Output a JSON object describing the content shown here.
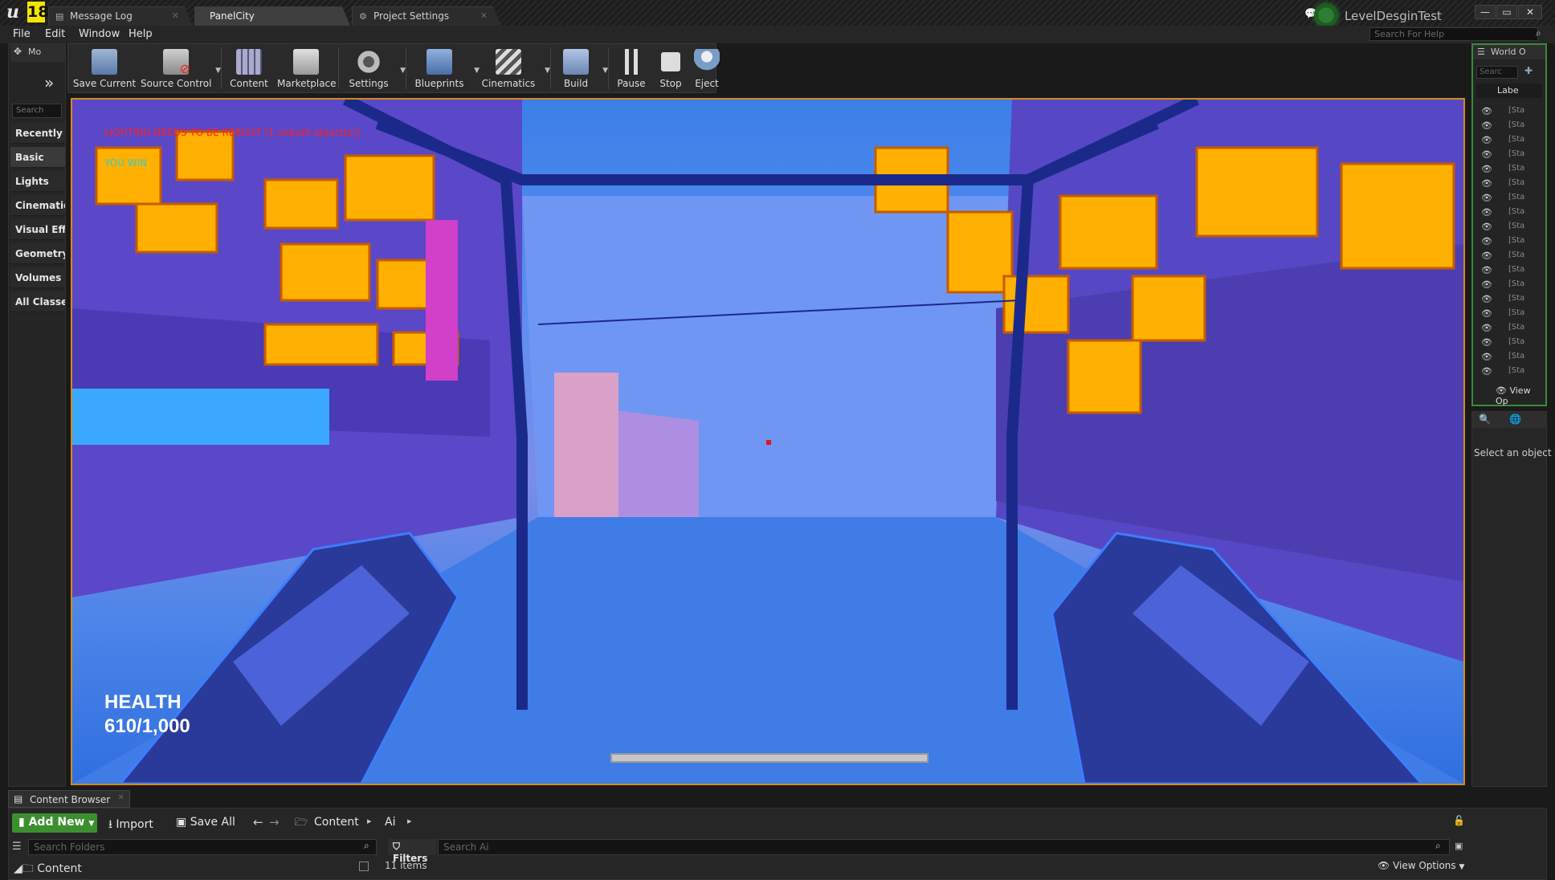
{
  "tabs": [
    {
      "label": "Message Log"
    },
    {
      "label": "PanelCity"
    },
    {
      "label": "Project Settings"
    }
  ],
  "project_name": "LevelDesginTest",
  "window_controls": [
    "—",
    "▭",
    "✕"
  ],
  "menu": [
    "File",
    "Edit",
    "Window",
    "Help"
  ],
  "help_search_placeholder": "Search For Help",
  "modes": {
    "tab_label": "Mo",
    "search_placeholder": "Search",
    "items": [
      "Recently P",
      "Basic",
      "Lights",
      "Cinematic",
      "Visual Effe",
      "Geometry",
      "Volumes",
      "All Classes"
    ],
    "selected": "Basic"
  },
  "toolbar": [
    {
      "label": "Save Current",
      "icon": "save-icon"
    },
    {
      "label": "Source Control",
      "icon": "source-control-icon"
    },
    {
      "label": "Content",
      "icon": "content-icon"
    },
    {
      "label": "Marketplace",
      "icon": "marketplace-icon"
    },
    {
      "label": "Settings",
      "icon": "settings-icon"
    },
    {
      "label": "Blueprints",
      "icon": "blueprints-icon"
    },
    {
      "label": "Cinematics",
      "icon": "cinematics-icon"
    },
    {
      "label": "Build",
      "icon": "build-icon"
    },
    {
      "label": "Pause",
      "icon": "pause-icon"
    },
    {
      "label": "Stop",
      "icon": "stop-icon"
    },
    {
      "label": "Eject",
      "icon": "eject-icon"
    }
  ],
  "viewport": {
    "warning": "LIGHTING NEEDS TO BE REBUILT (1 unbuilt object(s))",
    "message": "YOU WIN",
    "health_label": "HEALTH",
    "health_value": "610/1,000",
    "health_fraction": 0.61
  },
  "world_outliner": {
    "tab_label": "World O",
    "search_placeholder": "Searc",
    "column_label": "Labe",
    "row_label": "[Sta",
    "row_count": 19,
    "view_options": "View Op"
  },
  "details": {
    "hint": "Select an object t"
  },
  "content_browser": {
    "tab_label": "Content Browser",
    "add_new": "Add New",
    "import": "Import",
    "save_all": "Save All",
    "path": [
      "Content",
      "Ai"
    ],
    "folder_search_placeholder": "Search Folders",
    "filters": "Filters",
    "asset_search_placeholder": "Search Ai",
    "tree_root": "Content",
    "item_count": "11 items",
    "view_options": "View Options"
  },
  "colors": {
    "viewport_border": "#d28a1e",
    "add_new": "#3b8f2e",
    "warning": "#ff2020",
    "outliner_border": "#3a8a3a"
  }
}
